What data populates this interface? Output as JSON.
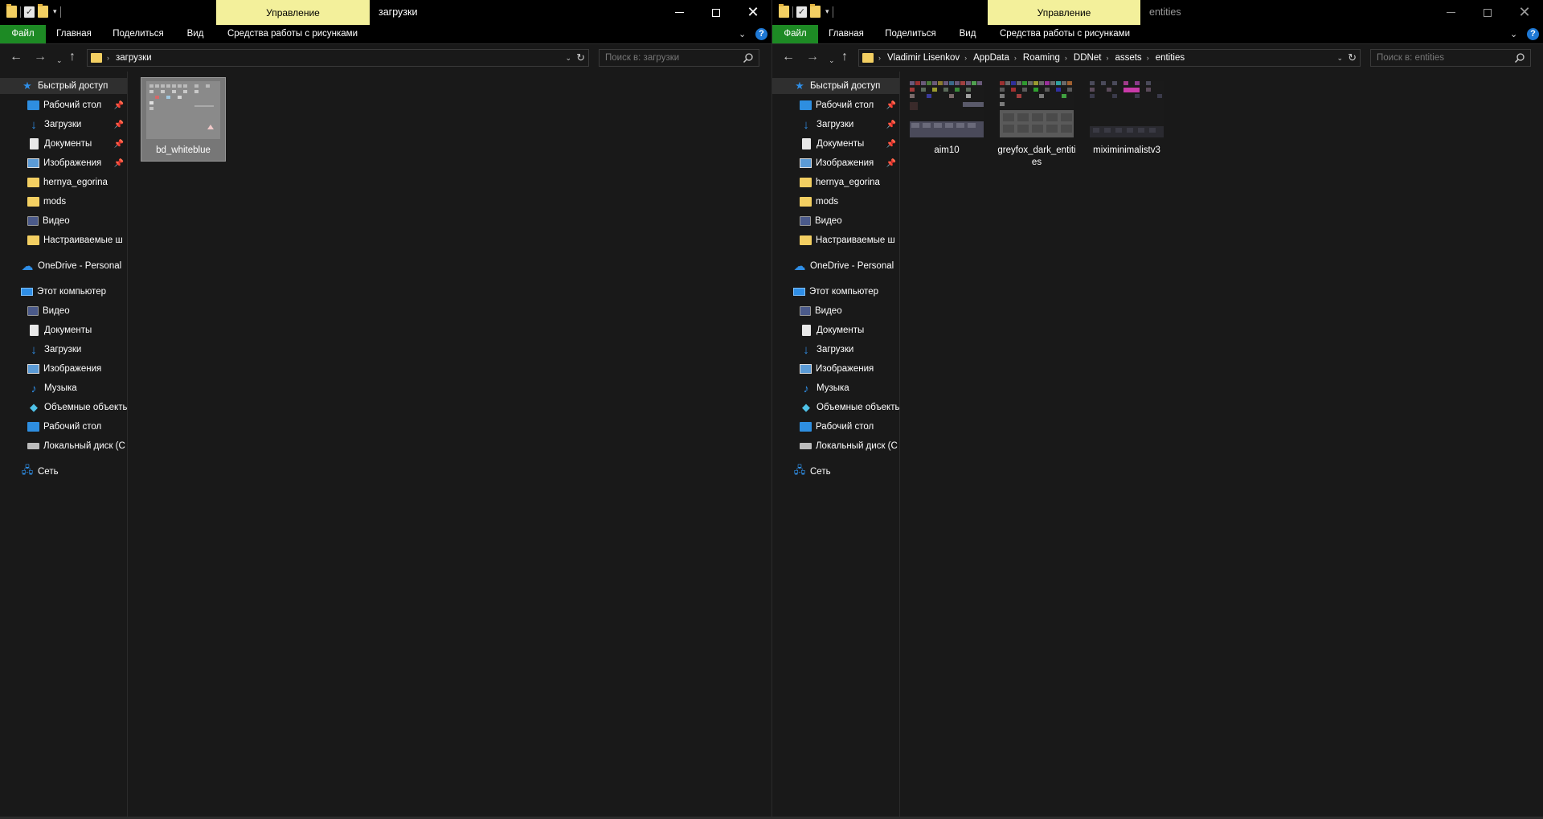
{
  "left": {
    "title": "загрузки",
    "manage_tab": "Управление",
    "ribbon": {
      "file": "Файл",
      "home": "Главная",
      "share": "Поделиться",
      "view": "Вид",
      "tools": "Средства работы с рисунками"
    },
    "address": {
      "crumbs": [
        "загрузки"
      ]
    },
    "search_placeholder": "Поиск в: загрузки",
    "nav": {
      "quick_access": "Быстрый доступ",
      "quick_items": [
        "Рабочий стол",
        "Загрузки",
        "Документы",
        "Изображения",
        "hernya_egorina",
        "mods",
        "Видео",
        "Настраиваемые ш"
      ],
      "onedrive": "OneDrive - Personal",
      "this_pc": "Этот компьютер",
      "pc_items": [
        "Видео",
        "Документы",
        "Загрузки",
        "Изображения",
        "Музыка",
        "Объемные объекты",
        "Рабочий стол",
        "Локальный диск (C"
      ],
      "network": "Сеть"
    },
    "files": [
      {
        "name": "bd_whiteblue"
      }
    ]
  },
  "right": {
    "title": "entities",
    "manage_tab": "Управление",
    "ribbon": {
      "file": "Файл",
      "home": "Главная",
      "share": "Поделиться",
      "view": "Вид",
      "tools": "Средства работы с рисунками"
    },
    "address": {
      "crumbs": [
        "Vladimir Lisenkov",
        "AppData",
        "Roaming",
        "DDNet",
        "assets",
        "entities"
      ]
    },
    "search_placeholder": "Поиск в: entities",
    "nav": {
      "quick_access": "Быстрый доступ",
      "quick_items": [
        "Рабочий стол",
        "Загрузки",
        "Документы",
        "Изображения",
        "hernya_egorina",
        "mods",
        "Видео",
        "Настраиваемые ш"
      ],
      "onedrive": "OneDrive - Personal",
      "this_pc": "Этот компьютер",
      "pc_items": [
        "Видео",
        "Документы",
        "Загрузки",
        "Изображения",
        "Музыка",
        "Объемные объекты",
        "Рабочий стол",
        "Локальный диск (C"
      ],
      "network": "Сеть"
    },
    "files": [
      {
        "name": "aim10"
      },
      {
        "name": "greyfox_dark_entities"
      },
      {
        "name": "miximinimalistv3"
      }
    ]
  },
  "colors": {
    "file_tab": "#1d8a24",
    "manage_tab": "#f3f09b",
    "accent": "#2f8ee6",
    "folder": "#f3cf62"
  }
}
